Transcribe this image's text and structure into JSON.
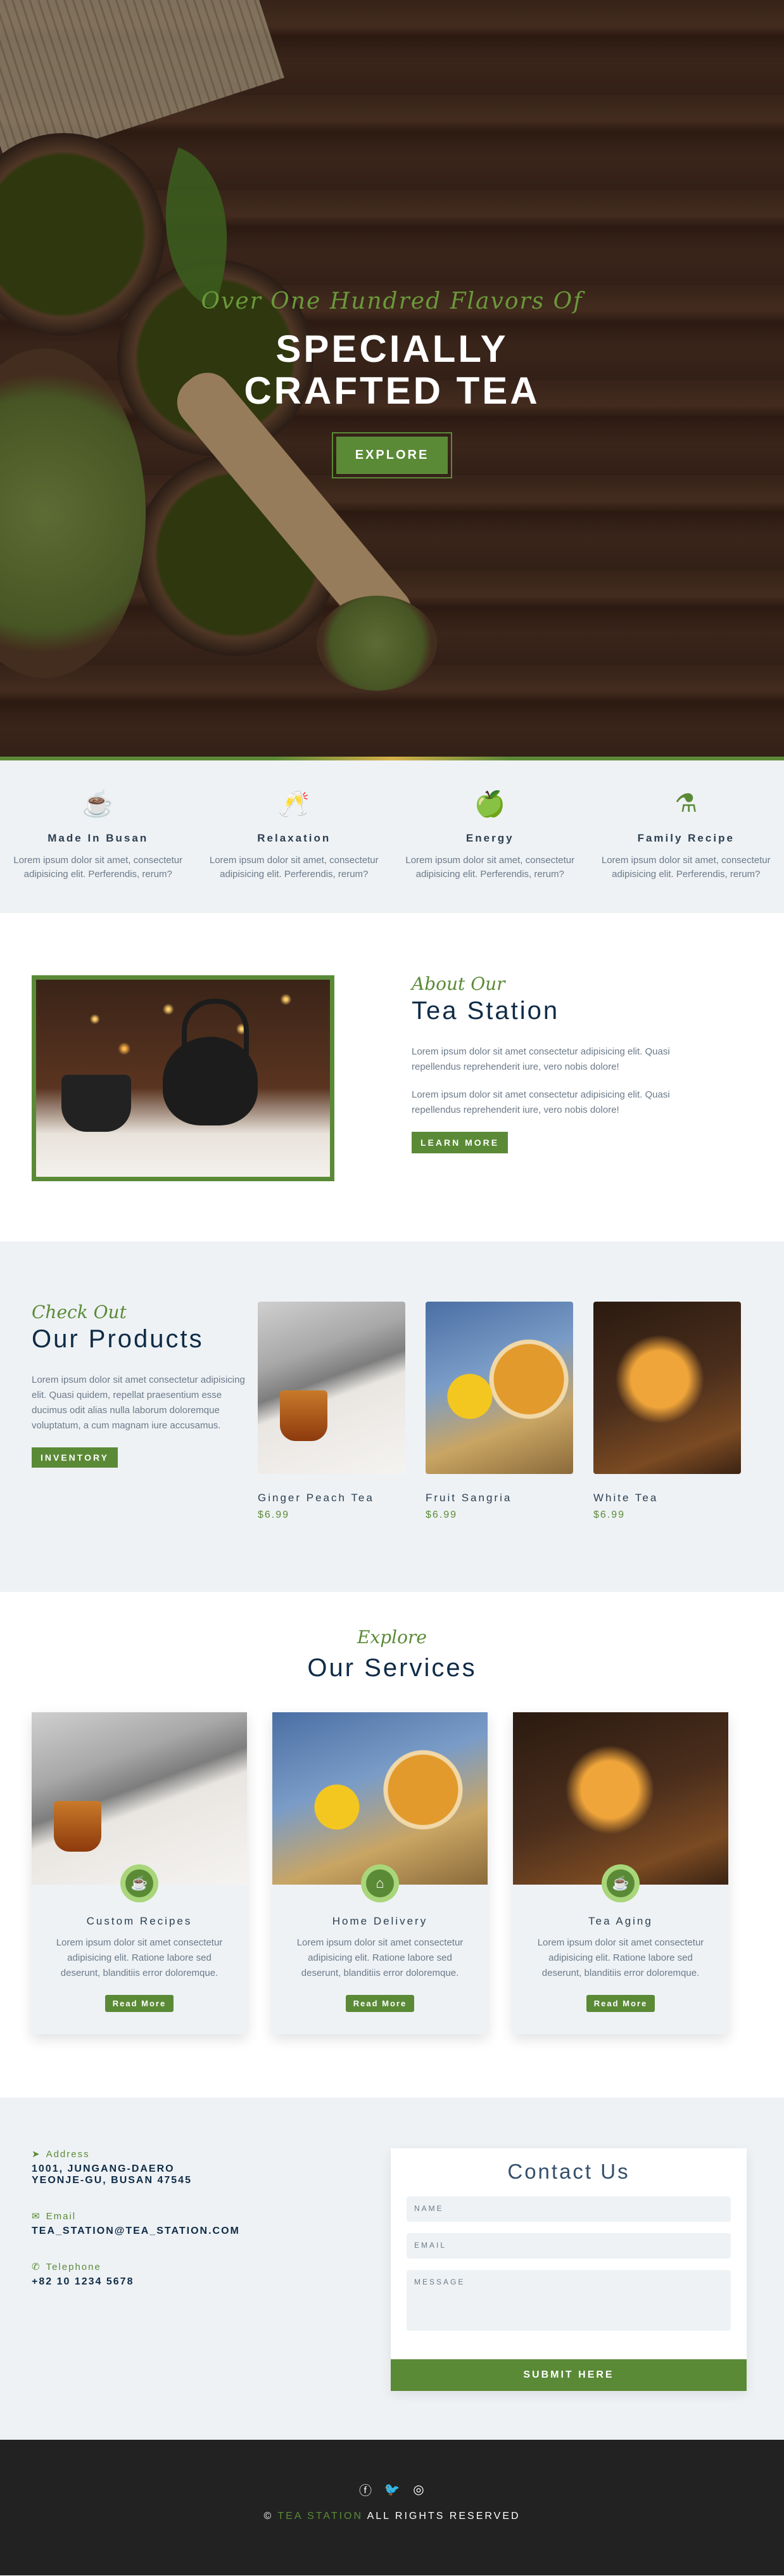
{
  "hero": {
    "subtitle": "Over One Hundred Flavors Of",
    "title_line1": "SPECIALLY",
    "title_line2": "CRAFTED TEA",
    "button": "EXPLORE"
  },
  "features": [
    {
      "icon": "mug-icon",
      "glyph": "☕",
      "title": "Made In Busan",
      "text": "Lorem ipsum dolor sit amet, consectetur adipisicing elit. Perferendis, rerum?"
    },
    {
      "icon": "cheers-icon",
      "glyph": "🥂",
      "title": "Relaxation",
      "text": "Lorem ipsum dolor sit amet, consectetur adipisicing elit. Perferendis, rerum?"
    },
    {
      "icon": "apple-icon",
      "glyph": "🍏",
      "title": "Energy",
      "text": "Lorem ipsum dolor sit amet, consectetur adipisicing elit. Perferendis, rerum?"
    },
    {
      "icon": "mortar-pestle-icon",
      "glyph": "⚗",
      "title": "Family Recipe",
      "text": "Lorem ipsum dolor sit amet, consectetur adipisicing elit. Perferendis, rerum?"
    }
  ],
  "about": {
    "script": "About Our",
    "title": "Tea Station",
    "p1": "Lorem ipsum dolor sit amet consectetur adipisicing elit. Quasi repellendus reprehenderit iure, vero nobis dolore!",
    "p2": "Lorem ipsum dolor sit amet consectetur adipisicing elit. Quasi repellendus reprehenderit iure, vero nobis dolore!",
    "button": "LEARN MORE"
  },
  "products": {
    "script": "Check Out",
    "title": "Our Products",
    "text": "Lorem ipsum dolor sit amet consectetur adipisicing elit. Quasi quidem, repellat praesentium esse ducimus odit alias nulla laborum doloremque voluptatum, a cum magnam iure accusamus.",
    "button": "INVENTORY",
    "items": [
      {
        "name": "Ginger Peach Tea",
        "price": "$6.99"
      },
      {
        "name": "Fruit Sangria",
        "price": "$6.99"
      },
      {
        "name": "White Tea",
        "price": "$6.99"
      }
    ]
  },
  "services": {
    "script": "Explore",
    "title": "Our Services",
    "items": [
      {
        "icon": "mug-icon",
        "glyph": "☕",
        "title": "Custom Recipes",
        "text": "Lorem ipsum dolor sit amet consectetur adipisicing elit. Ratione labore sed deserunt, blanditiis error doloremque.",
        "button": "Read More"
      },
      {
        "icon": "home-icon",
        "glyph": "⌂",
        "title": "Home Delivery",
        "text": "Lorem ipsum dolor sit amet consectetur adipisicing elit. Ratione labore sed deserunt, blanditiis error doloremque.",
        "button": "Read More"
      },
      {
        "icon": "mug-icon",
        "glyph": "☕",
        "title": "Tea Aging",
        "text": "Lorem ipsum dolor sit amet consectetur adipisicing elit. Ratione labore sed deserunt, blanditiis error doloremque.",
        "button": "Read More"
      }
    ]
  },
  "contact": {
    "address_label": "Address",
    "address_line1": "1001, Jungang-daero",
    "address_line2": "Yeonje-gu, Busan 47545",
    "email_label": "Email",
    "email_value": "tea_station@tea_station.com",
    "phone_label": "Telephone",
    "phone_value": "+82 10 1234 5678",
    "form_title": "Contact Us",
    "name_placeholder": "NAME",
    "email_placeholder": "EMAIL",
    "message_placeholder": "MESSAGE",
    "submit": "SUBMIT HERE"
  },
  "footer": {
    "copyright_symbol": "©",
    "brand": "TEA STATION",
    "rights": "ALL RIGHTS RESERVED"
  },
  "colors": {
    "accent": "#5b8a37",
    "navy": "#0f2b46",
    "light_bg": "#eef2f5",
    "footer_bg": "#222222"
  }
}
